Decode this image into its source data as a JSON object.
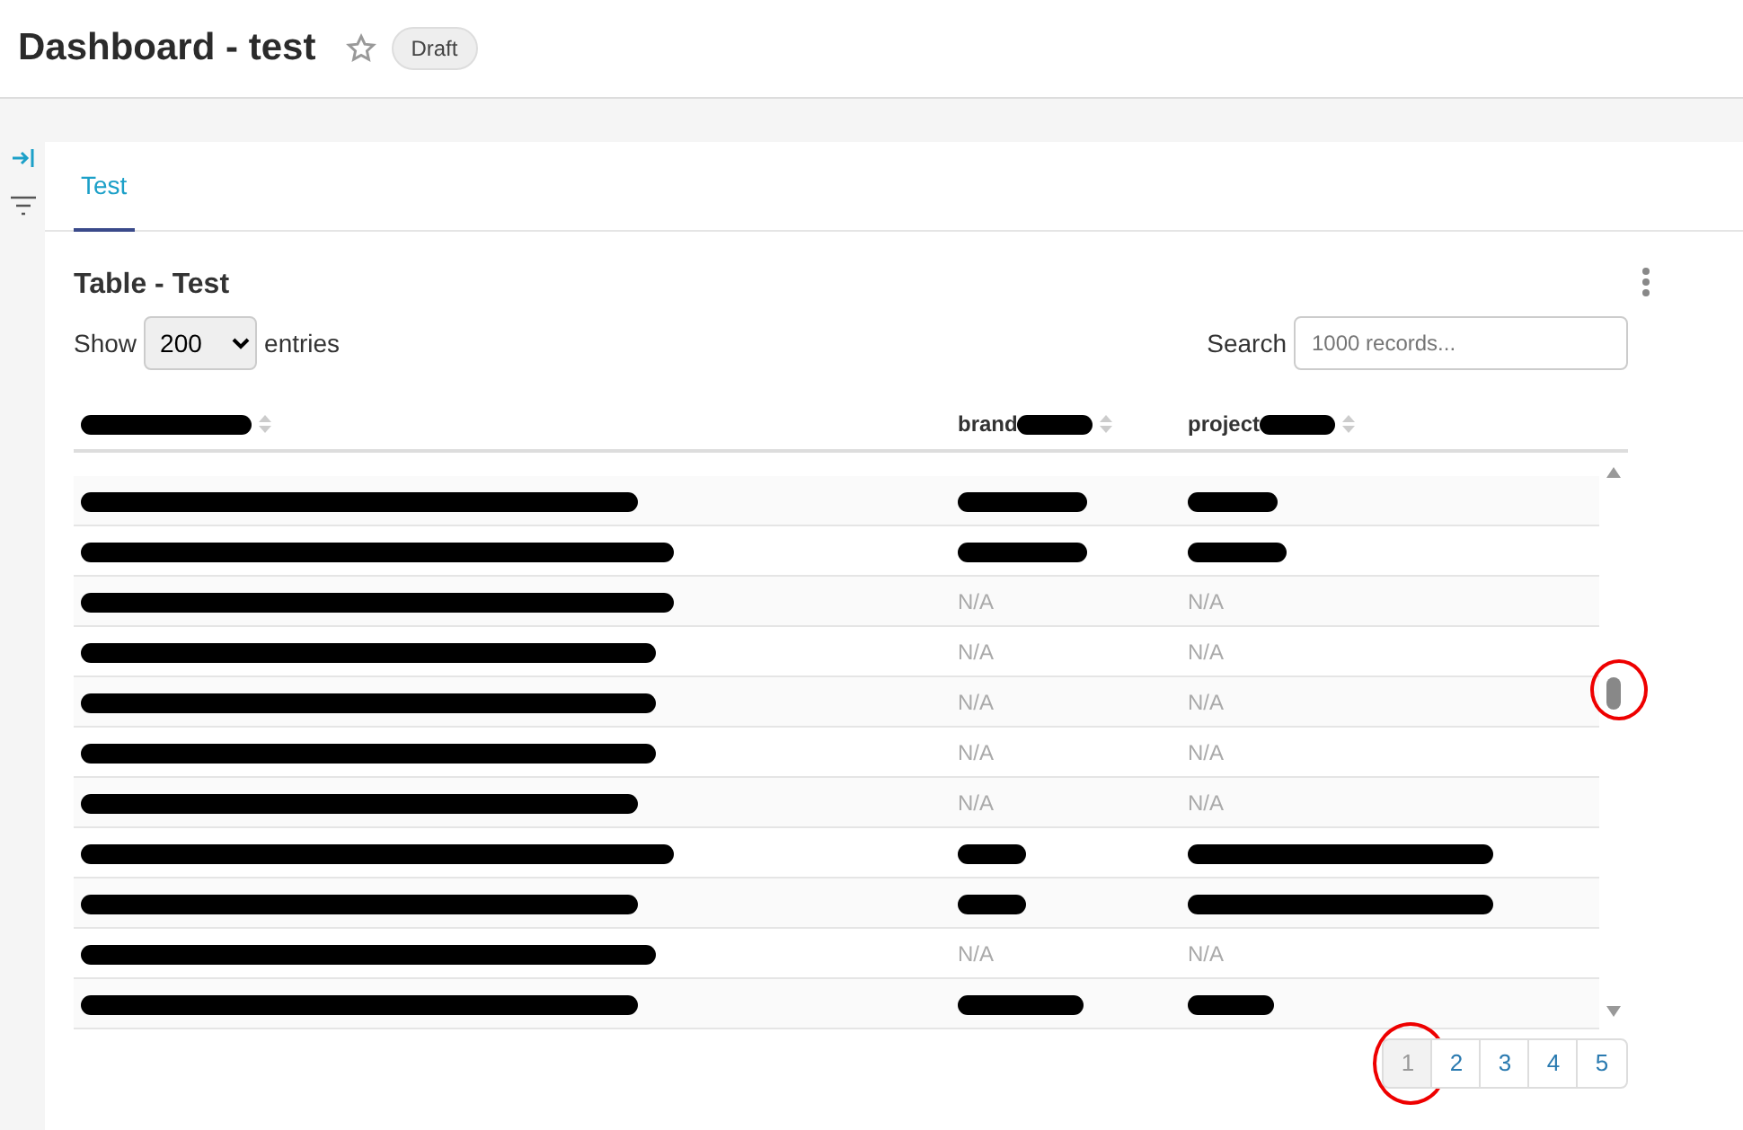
{
  "page": {
    "title": "Dashboard - test",
    "favorite": false,
    "status": "Draft"
  },
  "tabs": [
    {
      "label": "Test",
      "selected": true
    }
  ],
  "widget": {
    "title": "Table - Test",
    "length": {
      "before": "Show",
      "value": "200",
      "after": "entries"
    },
    "search": {
      "label": "Search",
      "placeholder": "1000 records..."
    },
    "columns": [
      {
        "redacted": true
      },
      {
        "label": "brand",
        "redacted": true
      },
      {
        "label": "project",
        "redacted": true
      }
    ],
    "rows": [
      {
        "cells": [
          {
            "redacted": true
          },
          {
            "redacted": true
          },
          {
            "redacted": true
          }
        ]
      },
      {
        "cells": [
          {
            "redacted": true
          },
          {
            "redacted": true
          },
          {
            "redacted": true
          }
        ]
      },
      {
        "cells": [
          {
            "redacted": true
          },
          {
            "text": "N/A",
            "redacted": false
          },
          {
            "text": "N/A",
            "redacted": false
          }
        ]
      },
      {
        "cells": [
          {
            "redacted": true
          },
          {
            "text": "N/A",
            "redacted": false
          },
          {
            "text": "N/A",
            "redacted": false
          }
        ]
      },
      {
        "cells": [
          {
            "redacted": true
          },
          {
            "text": "N/A",
            "redacted": false
          },
          {
            "text": "N/A",
            "redacted": false
          }
        ]
      },
      {
        "cells": [
          {
            "redacted": true
          },
          {
            "text": "N/A",
            "redacted": false
          },
          {
            "text": "N/A",
            "redacted": false
          }
        ]
      },
      {
        "cells": [
          {
            "redacted": true
          },
          {
            "text": "N/A",
            "redacted": false
          },
          {
            "text": "N/A",
            "redacted": false
          }
        ]
      },
      {
        "cells": [
          {
            "redacted": true
          },
          {
            "redacted": true
          },
          {
            "redacted": true
          }
        ]
      },
      {
        "cells": [
          {
            "redacted": true
          },
          {
            "redacted": true
          },
          {
            "redacted": true
          }
        ]
      },
      {
        "cells": [
          {
            "redacted": true
          },
          {
            "text": "N/A",
            "redacted": false
          },
          {
            "text": "N/A",
            "redacted": false
          }
        ]
      },
      {
        "cells": [
          {
            "redacted": true
          },
          {
            "redacted": true
          },
          {
            "redacted": true
          }
        ]
      }
    ],
    "scrollbar": {
      "circled": true
    },
    "pages": [
      {
        "label": "1",
        "selected": true,
        "circled": true
      },
      {
        "label": "2",
        "selected": false,
        "circled": false
      },
      {
        "label": "3",
        "selected": false,
        "circled": false
      },
      {
        "label": "4",
        "selected": false,
        "circled": false
      },
      {
        "label": "5",
        "selected": false,
        "circled": false
      }
    ]
  }
}
